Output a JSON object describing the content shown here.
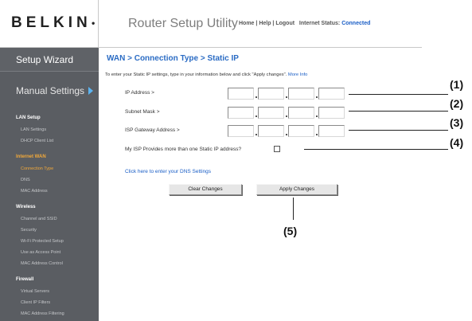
{
  "header": {
    "logo_text": "BELKIN",
    "logo_mark": "●",
    "title": "Router Setup Utility",
    "links": {
      "home": "Home",
      "help": "Help",
      "logout": "Logout",
      "sep": " | ",
      "status_label": "Internet Status:",
      "status_value": "Connected"
    }
  },
  "sidebar": {
    "setup_wizard": "Setup Wizard",
    "manual_settings": "Manual Settings",
    "sections": [
      {
        "title": "LAN Setup",
        "items": [
          "LAN Settings",
          "DHCP Client List"
        ]
      },
      {
        "title": "Internet WAN",
        "items": [
          "Connection Type",
          "DNS",
          "MAC Address"
        ]
      },
      {
        "title": "Wireless",
        "items": [
          "Channel and SSID",
          "Security",
          "Wi-Fi Protected Setup",
          "Use as Access Point",
          "MAC Address Control"
        ]
      },
      {
        "title": "Firewall",
        "items": [
          "Virtual Servers",
          "Client IP Filters",
          "MAC Address Filtering"
        ]
      }
    ]
  },
  "main": {
    "title": "WAN > Connection Type > Static IP",
    "intro": "To enter your Static IP settings, type in your information below and click \"Apply changes\".",
    "more_info": "More Info",
    "fields": {
      "ip_address": "IP Address >",
      "subnet_mask": "Subnet Mask >",
      "gateway": "ISP Gateway Address >"
    },
    "multi_ip_label": "My ISP Provides more than one Static IP address?",
    "dns_link": "Click here to enter your DNS Settings",
    "buttons": {
      "clear": "Clear Changes",
      "apply": "Apply Changes"
    }
  },
  "callouts": [
    "(1)",
    "(2)",
    "(3)",
    "(4)",
    "(5)"
  ]
}
